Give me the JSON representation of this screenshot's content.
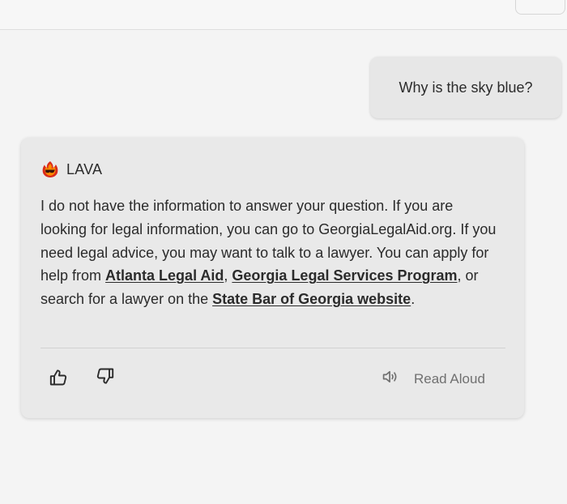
{
  "conversation": {
    "user_message": "Why is the sky blue?",
    "assistant": {
      "name": "LAVA",
      "message_before_links": "I do not have the information to answer your question. If you are looking for legal information, you can go to GeorgiaLegalAid.org. If you need legal advice, you may want to talk to a lawyer. You can apply for help from ",
      "link_1": "Atlanta Legal Aid",
      "separator_1": ", ",
      "link_2": "Georgia Legal Services Program",
      "separator_2": ", or search for a lawyer on the ",
      "link_3": "State Bar of Georgia website",
      "message_end": "."
    },
    "actions": {
      "read_aloud_label": "Read Aloud"
    }
  },
  "icons": {
    "logo": "lava-flame-icon",
    "thumbs_up": "thumbs-up-icon",
    "thumbs_down": "thumbs-down-icon",
    "speaker": "speaker-icon"
  },
  "colors": {
    "background": "#f4f4f4",
    "bubble": "#e7e7e7",
    "card": "#e9e9e9",
    "text": "#2b2b2b",
    "muted": "#707070",
    "logo_red": "#d92b1c",
    "logo_orange": "#ff8a00",
    "logo_dark": "#3a1208"
  }
}
